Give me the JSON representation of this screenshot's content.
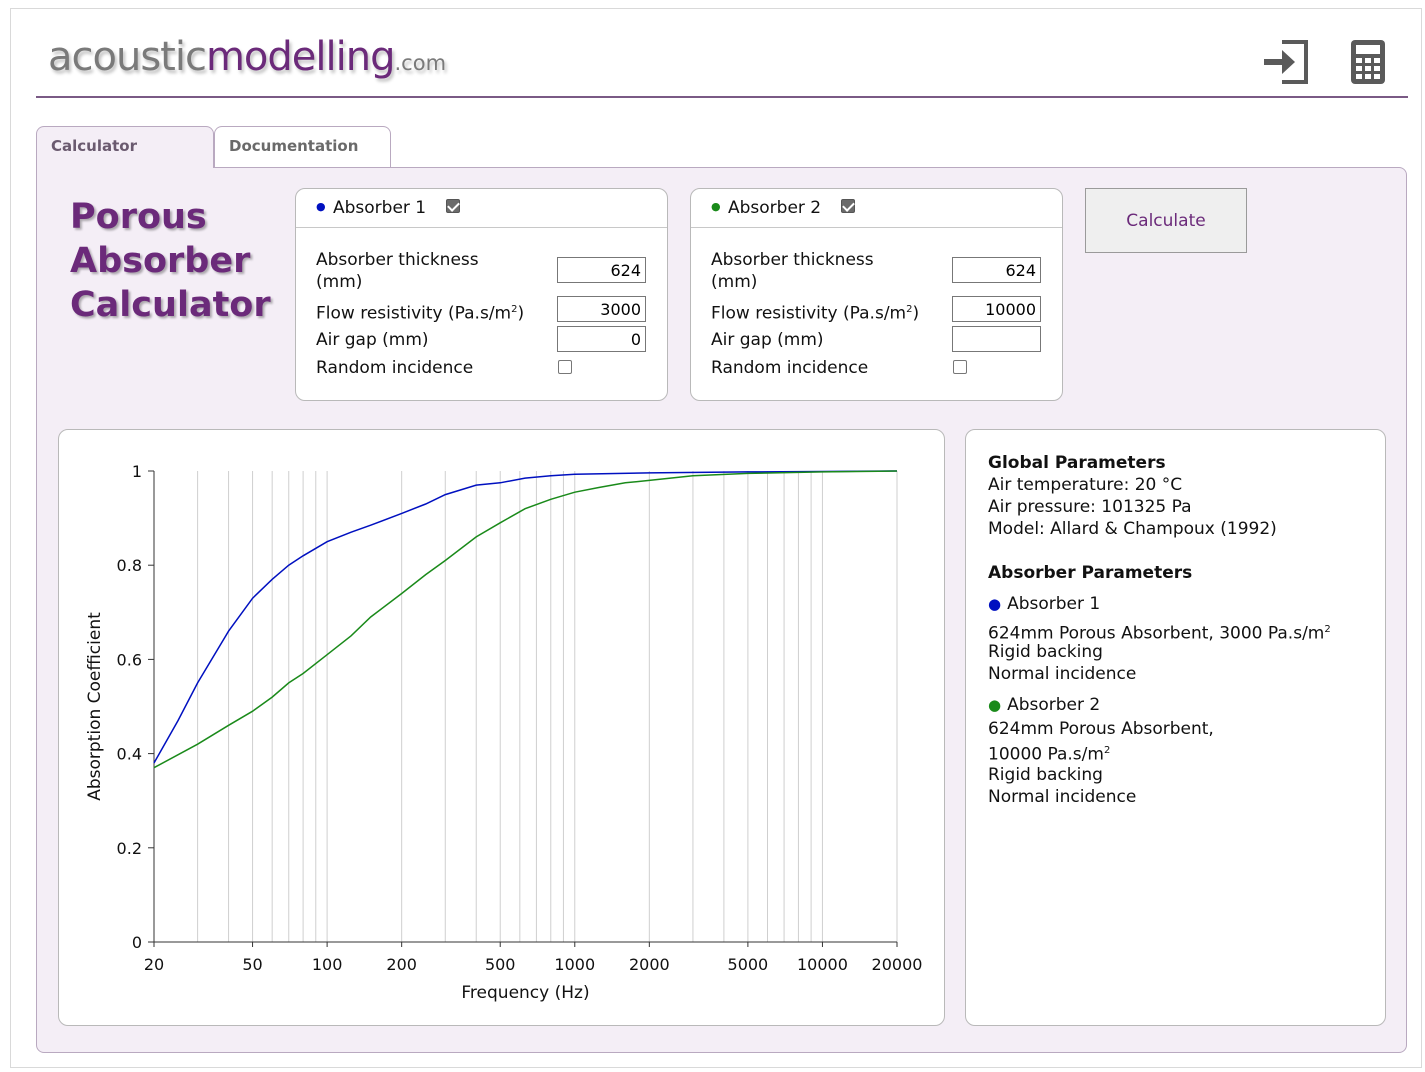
{
  "header": {
    "logo_part1": "acoustic",
    "logo_part2": "modelling",
    "logo_part3": ".com",
    "icons": [
      "login-icon",
      "calculator-icon"
    ]
  },
  "tabs": [
    {
      "label": "Calculator",
      "active": true
    },
    {
      "label": "Documentation",
      "active": false
    }
  ],
  "title_lines": [
    "Porous",
    "Absorber",
    "Calculator"
  ],
  "absorbers": [
    {
      "name": "Absorber 1",
      "color": "#0010c0",
      "enabled": true,
      "thickness_label": "Absorber thickness",
      "thickness_unit": "(mm)",
      "thickness": "624",
      "flow_label": "Flow resistivity (Pa.s/m",
      "flow_sup": "2",
      "flow_close": ")",
      "flow": "3000",
      "airgap_label": "Air gap (mm)",
      "airgap": "0",
      "random_label": "Random incidence",
      "random": false
    },
    {
      "name": "Absorber 2",
      "color": "#1a8a1a",
      "enabled": true,
      "thickness_label": "Absorber thickness",
      "thickness_unit": "(mm)",
      "thickness": "624",
      "flow_label": "Flow resistivity (Pa.s/m",
      "flow_sup": "2",
      "flow_close": ")",
      "flow": "10000",
      "airgap_label": "Air gap (mm)",
      "airgap": "",
      "random_label": "Random incidence",
      "random": false
    }
  ],
  "calculate_label": "Calculate",
  "chart_data": {
    "type": "line",
    "xlabel": "Frequency (Hz)",
    "ylabel": "Absorption Coefficient",
    "xscale": "log",
    "xlim": [
      20,
      20000
    ],
    "ylim": [
      0,
      1
    ],
    "xticks": [
      20,
      50,
      100,
      200,
      500,
      1000,
      2000,
      5000,
      10000,
      20000
    ],
    "yticks": [
      0,
      0.2,
      0.4,
      0.6,
      0.8,
      1
    ],
    "ytick_labels": [
      "0",
      "0.2",
      "0.4",
      "0.6",
      "0.8",
      "1"
    ],
    "grid": "vertical",
    "series": [
      {
        "color": "#0010c0",
        "x": [
          20,
          25,
          30,
          40,
          50,
          60,
          70,
          80,
          100,
          125,
          150,
          200,
          250,
          300,
          400,
          500,
          630,
          800,
          1000,
          2000,
          5000,
          10000,
          20000
        ],
        "y": [
          0.38,
          0.47,
          0.55,
          0.66,
          0.73,
          0.77,
          0.8,
          0.82,
          0.85,
          0.87,
          0.885,
          0.91,
          0.93,
          0.95,
          0.97,
          0.975,
          0.985,
          0.99,
          0.993,
          0.996,
          0.998,
          0.999,
          1.0
        ]
      },
      {
        "color": "#1a8a1a",
        "x": [
          20,
          30,
          40,
          50,
          60,
          70,
          80,
          100,
          125,
          150,
          200,
          250,
          300,
          400,
          500,
          630,
          800,
          1000,
          1250,
          1600,
          2000,
          3000,
          5000,
          10000,
          20000
        ],
        "y": [
          0.37,
          0.42,
          0.46,
          0.49,
          0.52,
          0.55,
          0.57,
          0.61,
          0.65,
          0.69,
          0.74,
          0.78,
          0.81,
          0.86,
          0.89,
          0.92,
          0.94,
          0.955,
          0.965,
          0.975,
          0.98,
          0.99,
          0.995,
          0.998,
          1.0
        ]
      }
    ]
  },
  "info": {
    "global_heading": "Global Parameters",
    "air_temperature": "Air temperature: 20 °C",
    "air_pressure": "Air pressure: 101325 Pa",
    "model": "Model: Allard & Champoux (1992)",
    "absorber_heading": "Absorber Parameters",
    "a1_name": "Absorber 1",
    "a1_desc": "624mm Porous Absorbent, 3000 Pa.s/m",
    "a1_sup": "2",
    "a1_backing": "Rigid backing",
    "a1_incidence": "Normal incidence",
    "a2_name": "Absorber 2",
    "a2_desc1": "624mm Porous Absorbent,",
    "a2_desc2": "10000 Pa.s/m",
    "a2_sup": "2",
    "a2_backing": "Rigid backing",
    "a2_incidence": "Normal incidence"
  }
}
